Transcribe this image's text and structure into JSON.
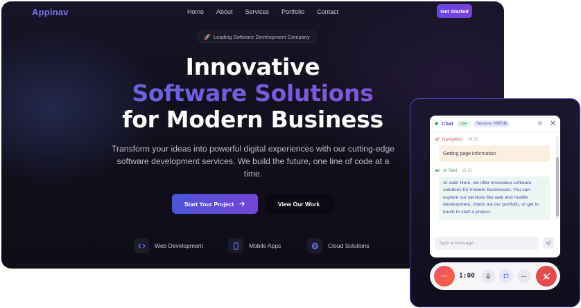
{
  "site": {
    "logo": "Appinav",
    "nav": [
      "Home",
      "About",
      "Services",
      "Portfolio",
      "Contact"
    ],
    "cta": "Get Started",
    "badge": "Leading Software Development Company",
    "hero": {
      "line1": "Innovative",
      "line2": "Software Solutions",
      "line3": "for Modern Business",
      "subtitle": "Transform your ideas into powerful digital experiences with our cutting-edge software development services. We build the future, one line of code at a time."
    },
    "buttons": {
      "primary": "Start Your Project",
      "secondary": "View Our Work"
    },
    "features": [
      {
        "label": "Web Development",
        "icon": "code-icon"
      },
      {
        "label": "Mobile Apps",
        "icon": "mobile-icon"
      },
      {
        "label": "Cloud Solutions",
        "icon": "globe-icon"
      }
    ],
    "colors": {
      "accent": "#6447e8",
      "gradient_start": "#5f67e0",
      "gradient_end": "#8b52d8",
      "background": "#110f1c"
    }
  },
  "chat": {
    "title": "Chat",
    "status": "Live",
    "session": "Session: 0995db",
    "messages": [
      {
        "sender": "Navigation",
        "time": "16:31",
        "text": "Getting page information"
      },
      {
        "sender": "AI Said",
        "time": "16:31",
        "text": "AI said: Here, we offer innovative software solutions for modern businesses. You can explore our services like web and mobile development, check out our portfolio, or get in touch to start a project."
      }
    ],
    "input_placeholder": "Type a message...",
    "timer": "1:00",
    "colors": {
      "live": "#2bb673",
      "end_call": "#e24c4c",
      "menu": "#ef4e6a"
    }
  }
}
